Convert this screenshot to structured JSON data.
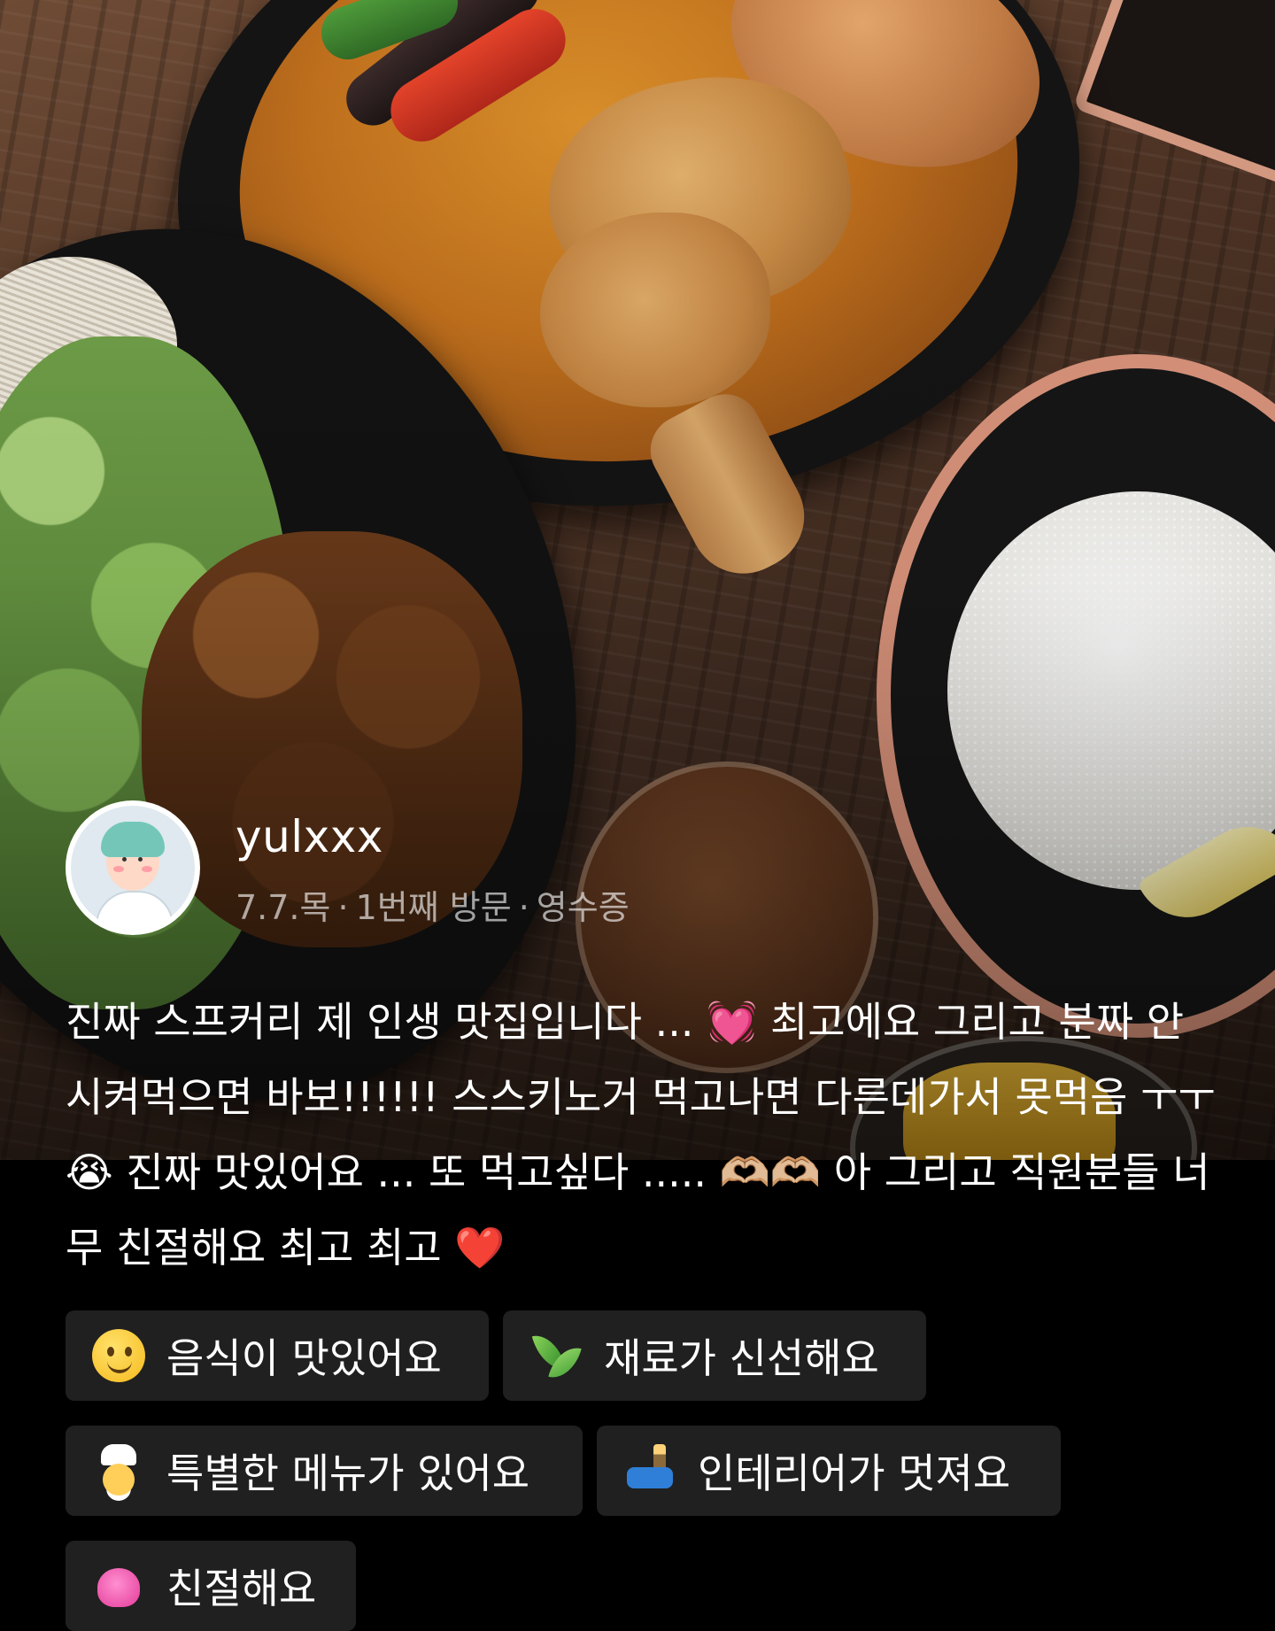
{
  "review": {
    "username": "yulxxx",
    "date": "7.7.목",
    "visit": "1번째 방문",
    "verification": "영수증",
    "separator": "·",
    "text": "진짜 스프커리 제 인생 맛집입니다 ... 💓 최고에요 그리고 분짜 안시켜먹으면 바보!!!!!! 스스키노거 먹고나면 다른데가서 못먹음 ㅜㅜ😭 진짜 맛있어요 ... 또 먹고싶다 ..... 🫶🏼🫶🏼 아 그리고 직원분들 너무 친절해요 최고 최고 ❤️"
  },
  "keywords": [
    {
      "label": "음식이 맛있어요",
      "icon": "smiley-yum-icon"
    },
    {
      "label": "재료가 신선해요",
      "icon": "leaf-icon"
    },
    {
      "label": "특별한 메뉴가 있어요",
      "icon": "chef-icon"
    },
    {
      "label": "인테리어가 멋져요",
      "icon": "sofa-lamp-icon"
    },
    {
      "label": "친절해요",
      "icon": "heart-icon"
    }
  ],
  "photo": {
    "subject": "soup-curry-with-chicken-rice-and-grilled-pork"
  },
  "colors": {
    "background": "#000000",
    "chip_background": "#202020",
    "meta_text": "#9e9e9e"
  }
}
